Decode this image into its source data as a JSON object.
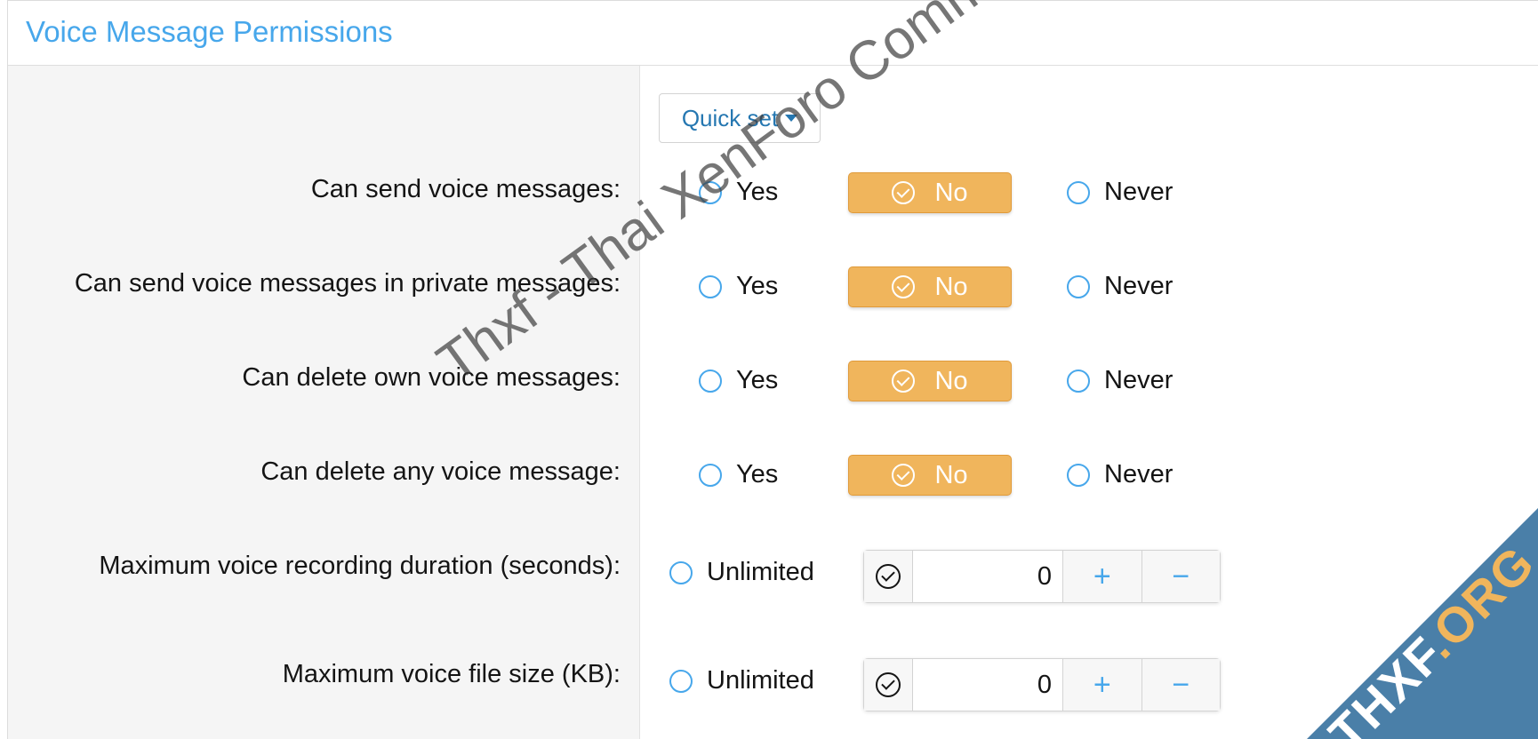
{
  "header": {
    "title": "Voice Message Permissions"
  },
  "quickset": {
    "label": "Quick set"
  },
  "permission_rows": [
    {
      "label": "Can send voice messages:",
      "options": [
        "Yes",
        "No",
        "Never"
      ],
      "selected": "No"
    },
    {
      "label": "Can send voice messages in private messages:",
      "options": [
        "Yes",
        "No",
        "Never"
      ],
      "selected": "No"
    },
    {
      "label": "Can delete own voice messages:",
      "options": [
        "Yes",
        "No",
        "Never"
      ],
      "selected": "No"
    },
    {
      "label": "Can delete any voice message:",
      "options": [
        "Yes",
        "No",
        "Never"
      ],
      "selected": "No"
    }
  ],
  "number_rows": [
    {
      "label": "Maximum voice recording duration (seconds):",
      "unlimited_label": "Unlimited",
      "value": "0",
      "plus": "+",
      "minus": "−"
    },
    {
      "label": "Maximum voice file size (KB):",
      "unlimited_label": "Unlimited",
      "value": "0",
      "plus": "+",
      "minus": "−"
    }
  ],
  "watermark": {
    "text": "Thxf - Thai XenForo Community"
  },
  "brand": {
    "thxf": "THXF",
    "org": ".ORG"
  },
  "colors": {
    "accent": "#47a7eb",
    "selected": "#f0b55c",
    "banner": "#4a7fa8"
  }
}
